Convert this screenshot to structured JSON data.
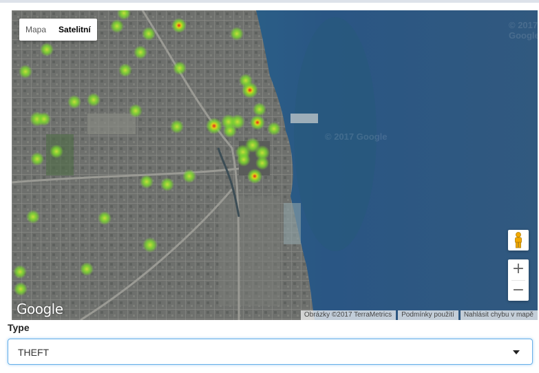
{
  "map": {
    "map_type_control": {
      "options": [
        "Mapa",
        "Satelitní"
      ],
      "selected": "Satelitní"
    },
    "zoom": {
      "in_label": "+",
      "out_label": "−"
    },
    "logo_text": "Google",
    "watermarks": [
      "© 2017 Google",
      "© 2017 Google"
    ],
    "attribution": {
      "imagery": "Obrázky ©2017 TerraMetrics",
      "terms": "Podmínky použití",
      "report": "Nahlásit chybu v mapě"
    },
    "heatmap_layer": "heatmap",
    "icons": {
      "pegman": "pegman-icon",
      "zoom_in": "plus-icon",
      "zoom_out": "minus-icon"
    }
  },
  "filter": {
    "label": "Type",
    "selected_value": "THEFT"
  },
  "colors": {
    "lake": "#2c5a82",
    "land": "#6b6e6c",
    "focus_border": "#66afe9",
    "heat_low": "#7bd62e",
    "heat_high": "#e8221b"
  }
}
